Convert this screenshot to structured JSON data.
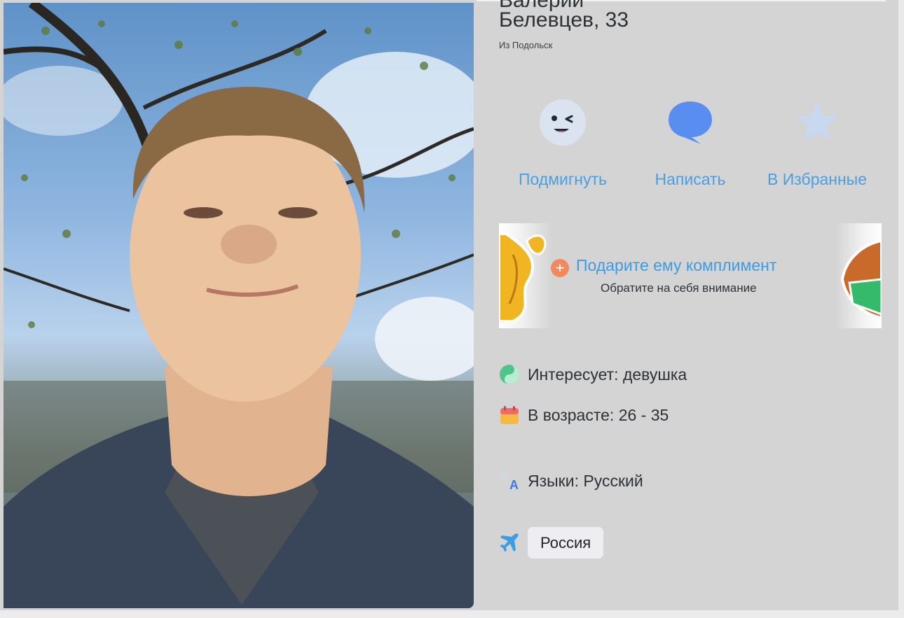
{
  "profile": {
    "name_line1": "Валерий",
    "name_line2": "Белевцев, 33",
    "city": "Из Подольск"
  },
  "actions": [
    {
      "label": "Подмигнуть",
      "icon": "wink-icon"
    },
    {
      "label": "Написать",
      "icon": "chat-bubble-icon"
    },
    {
      "label": "В Избранные",
      "icon": "star-icon"
    }
  ],
  "compliment": {
    "title": "Подарите ему комплимент",
    "subtitle": "Обратите на себя внимание"
  },
  "details": {
    "interest": "Интересует: девушка",
    "age_range": "В возрасте: 26 - 35",
    "languages": "Языки: Русский",
    "country": "Россия"
  },
  "colors": {
    "accent": "#4a9fe0",
    "background": "#d4d4d4",
    "plus_badge": "#f08a5c"
  }
}
